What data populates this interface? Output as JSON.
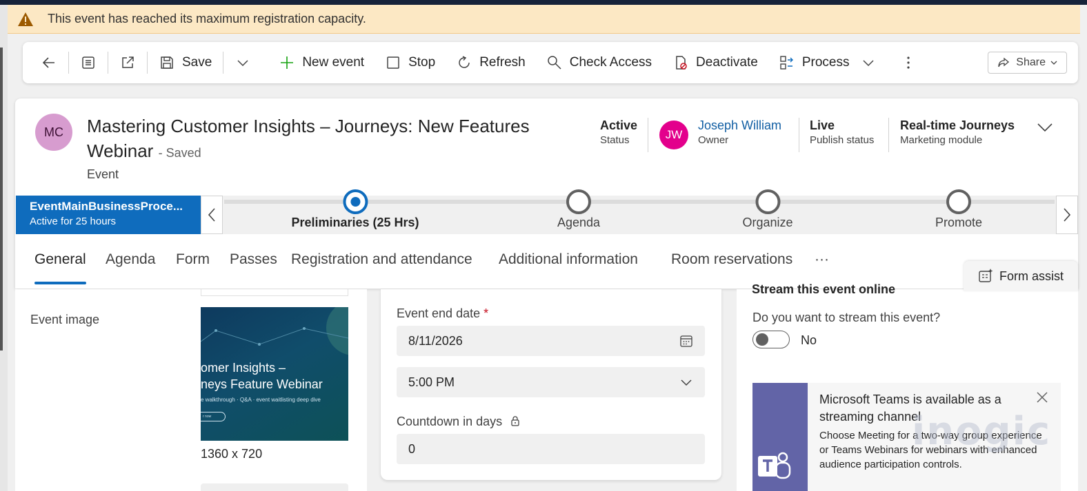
{
  "banner": {
    "message": "This event has reached its maximum registration capacity.",
    "icon": "warning-icon",
    "color": "#fce8c4"
  },
  "toolbar": {
    "save": "Save",
    "new_event": "New event",
    "stop": "Stop",
    "refresh": "Refresh",
    "check_access": "Check Access",
    "deactivate": "Deactivate",
    "process": "Process",
    "share": "Share"
  },
  "header": {
    "avatar_initials": "MC",
    "title": "Mastering Customer Insights – Journeys: New Features Webinar",
    "saved_state": "- Saved",
    "entity": "Event",
    "fields": {
      "status_value": "Active",
      "status_label": "Status",
      "owner_initials": "JW",
      "owner_value": "Joseph William",
      "owner_label": "Owner",
      "publish_value": "Live",
      "publish_label": "Publish status",
      "module_value": "Real-time Journeys",
      "module_label": "Marketing module"
    }
  },
  "bpf": {
    "process_name": "EventMainBusinessProce...",
    "active_for": "Active for 25 hours",
    "stages": [
      {
        "name": "Preliminaries  (25 Hrs)",
        "active": true
      },
      {
        "name": "Agenda",
        "active": false
      },
      {
        "name": "Organize",
        "active": false
      },
      {
        "name": "Promote",
        "active": false
      }
    ]
  },
  "tabs": [
    "General",
    "Agenda",
    "Form",
    "Passes",
    "Registration and attendance",
    "Additional information",
    "Room reservations",
    "···"
  ],
  "form_assist": "Form assist",
  "left_section": {
    "event_image_label": "Event image",
    "image_line1": "omer Insights –",
    "image_line2": "neys Feature Webinar",
    "image_line3": "e walkthrough · Q&A · event waitlisting deep dive",
    "image_button": "r now",
    "image_dimensions": "1360 x 720"
  },
  "middle_section": {
    "end_date_label": "Event end date",
    "required_mark": "*",
    "end_date_value": "8/11/2026",
    "end_time_value": "5:00 PM",
    "countdown_label": "Countdown in days",
    "countdown_value": "0"
  },
  "right_section": {
    "title": "Stream this event online",
    "question": "Do you want to stream this event?",
    "toggle_state": "No",
    "teams_title": "Microsoft Teams is available as a streaming channel",
    "teams_body": "Choose Meeting for a two-way group experience or Teams Webinars for webinars with enhanced audience participation controls."
  },
  "watermark": "inogic",
  "colors": {
    "accent": "#0f6cbd",
    "owner_avatar": "#e3008c",
    "teams": "#6264a7"
  }
}
